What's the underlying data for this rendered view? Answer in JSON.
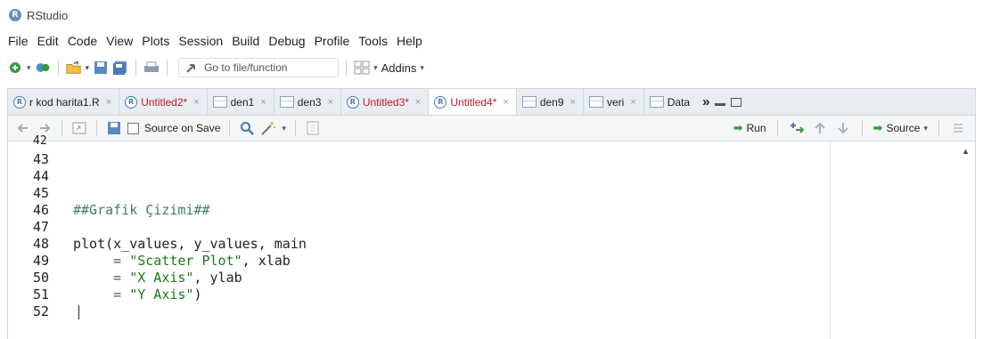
{
  "window": {
    "title": "RStudio",
    "logo_letter": "R"
  },
  "menu": [
    "File",
    "Edit",
    "Code",
    "View",
    "Plots",
    "Session",
    "Build",
    "Debug",
    "Profile",
    "Tools",
    "Help"
  ],
  "toolbar": {
    "goto_placeholder": "Go to file/function",
    "addins_label": "Addins"
  },
  "tabs": [
    {
      "label": "r kod harita1.R",
      "kind": "script",
      "unsaved": false,
      "active": false
    },
    {
      "label": "Untitled2*",
      "kind": "script",
      "unsaved": true,
      "active": false
    },
    {
      "label": "den1",
      "kind": "data",
      "unsaved": false,
      "active": false
    },
    {
      "label": "den3",
      "kind": "data",
      "unsaved": false,
      "active": false
    },
    {
      "label": "Untitled3*",
      "kind": "script",
      "unsaved": true,
      "active": false
    },
    {
      "label": "Untitled4*",
      "kind": "script",
      "unsaved": true,
      "active": true
    },
    {
      "label": "den9",
      "kind": "data",
      "unsaved": false,
      "active": false
    },
    {
      "label": "veri",
      "kind": "data",
      "unsaved": false,
      "active": false
    },
    {
      "label": "Data",
      "kind": "data",
      "unsaved": false,
      "active": false
    }
  ],
  "close_glyph": "×",
  "more_tabs": "»",
  "editor_toolbar": {
    "source_on_save": "Source on Save",
    "run": "Run",
    "source": "Source"
  },
  "editor": {
    "partial_line": "42",
    "lines": [
      {
        "num": "43",
        "text": ""
      },
      {
        "num": "44",
        "text": ""
      },
      {
        "num": "45",
        "text": ""
      },
      {
        "num": "46",
        "text": "##Grafik Çizimi##"
      },
      {
        "num": "47",
        "text": ""
      },
      {
        "num": "48",
        "text": "plot(x_values, y_values, main"
      },
      {
        "num": "49",
        "text": "     = \"Scatter Plot\", xlab"
      },
      {
        "num": "50",
        "text": "     = \"X Axis\", ylab"
      },
      {
        "num": "51",
        "text": "     = \"Y Axis\")"
      },
      {
        "num": "52",
        "text": ""
      }
    ]
  }
}
